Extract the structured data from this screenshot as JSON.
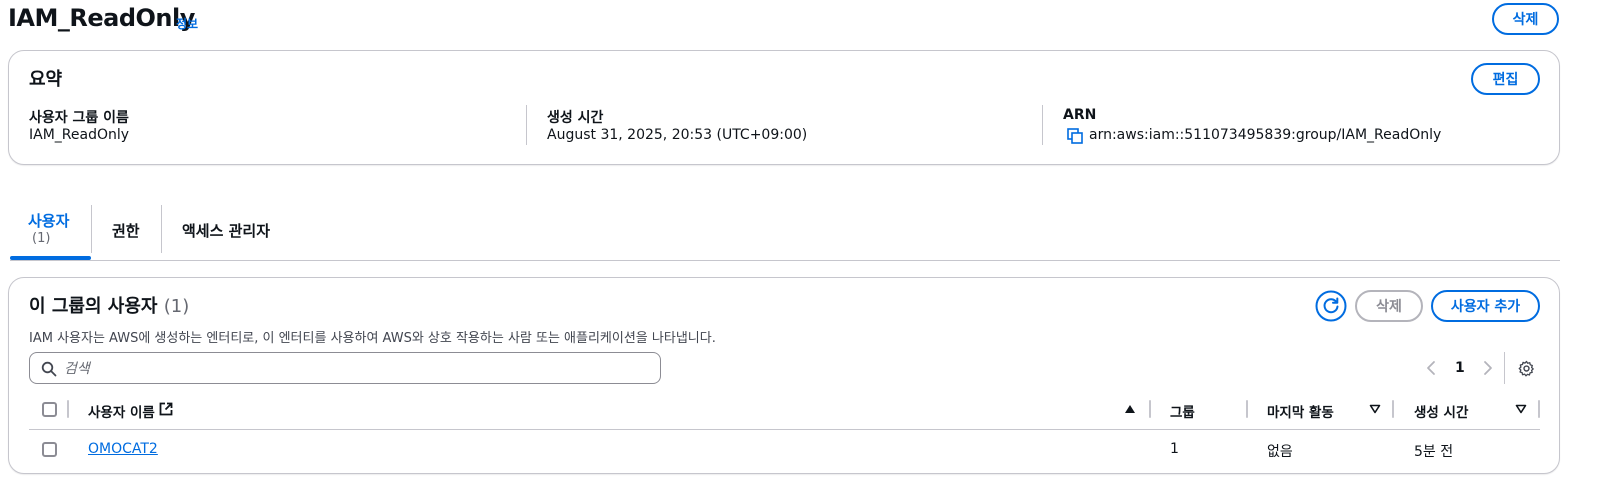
{
  "header": {
    "title": "IAM_ReadOnly",
    "info_link": "정보",
    "delete_button": "삭제"
  },
  "summary": {
    "title": "요약",
    "edit_button": "편집",
    "columns": [
      {
        "label": "사용자 그룹 이름",
        "value": "IAM_ReadOnly"
      },
      {
        "label": "생성 시간",
        "value": "August 31, 2025, 20:53 (UTC+09:00)"
      },
      {
        "label": "ARN",
        "value": "arn:aws:iam::511073495839:group/IAM_ReadOnly"
      }
    ]
  },
  "tabs": [
    {
      "label": "사용자",
      "count": "(1)",
      "active": true
    },
    {
      "label": "권한"
    },
    {
      "label": "액세스 관리자"
    }
  ],
  "users_panel": {
    "title": "이 그룹의 사용자",
    "count": "(1)",
    "description": "IAM 사용자는 AWS에 생성하는 엔터티로, 이 엔터티를 사용하여 AWS와 상호 작용하는 사람 또는 애플리케이션을 나타냅니다.",
    "delete_button": "삭제",
    "add_button": "사용자 추가",
    "search_placeholder": "검색",
    "pagination": {
      "current_page": "1"
    },
    "columns": [
      "사용자 이름",
      "그룹",
      "마지막 활동",
      "생성 시간"
    ],
    "rows": [
      {
        "username": "OMOCAT2",
        "groups": "1",
        "last_activity": "없음",
        "created": "5분 전"
      }
    ]
  },
  "colors": {
    "accent": "#006ce0",
    "border": "#c6c6cd",
    "disabled": "#8c8c94"
  }
}
